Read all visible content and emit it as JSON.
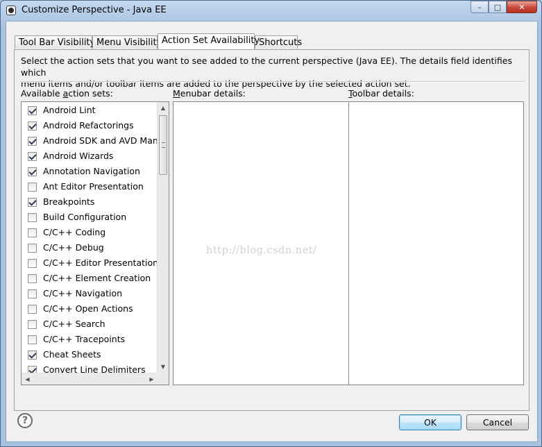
{
  "window": {
    "title": "Customize Perspective - Java EE",
    "buttons": {
      "minimize": "–",
      "maximize": "□",
      "close": "✕"
    }
  },
  "tabs": [
    {
      "label": "Tool Bar Visibility",
      "active": false
    },
    {
      "label": "Menu Visibility",
      "active": false
    },
    {
      "label": "Action Set Availability",
      "active": true
    },
    {
      "label": "Shortcuts",
      "active": false
    }
  ],
  "description_line1": "Select the action sets that you want to see added to the current perspective (Java EE).  The details field identifies which",
  "description_line2": "menu items and/or toolbar items are added to the perspective by the selected action set.",
  "labels": {
    "available_mnemonic": "a",
    "available_pre": "Available ",
    "available_post": "ction sets:",
    "menubar_mnemonic": "M",
    "menubar_post": "enubar details:",
    "toolbar_mnemonic": "T",
    "toolbar_post": "oolbar details:"
  },
  "action_sets": [
    {
      "label": "Android Lint",
      "checked": true
    },
    {
      "label": "Android Refactorings",
      "checked": true
    },
    {
      "label": "Android SDK and AVD Manager",
      "checked": true
    },
    {
      "label": "Android Wizards",
      "checked": true
    },
    {
      "label": "Annotation Navigation",
      "checked": true
    },
    {
      "label": "Ant Editor Presentation",
      "checked": false
    },
    {
      "label": "Breakpoints",
      "checked": true
    },
    {
      "label": "Build Configuration",
      "checked": false
    },
    {
      "label": "C/C++ Coding",
      "checked": false
    },
    {
      "label": "C/C++ Debug",
      "checked": false
    },
    {
      "label": "C/C++ Editor Presentation",
      "checked": false
    },
    {
      "label": "C/C++ Element Creation",
      "checked": false
    },
    {
      "label": "C/C++ Navigation",
      "checked": false
    },
    {
      "label": "C/C++ Open Actions",
      "checked": false
    },
    {
      "label": "C/C++ Search",
      "checked": false
    },
    {
      "label": "C/C++ Tracepoints",
      "checked": false
    },
    {
      "label": "Cheat Sheets",
      "checked": true
    },
    {
      "label": "Convert Line Delimiters",
      "checked": true
    }
  ],
  "watermark": "http://blog.csdn.net/",
  "footer": {
    "help": "?",
    "ok": "OK",
    "cancel": "Cancel"
  },
  "colors": {
    "title_bar": "#a7c1e1",
    "dialog_bg": "#f0f0f0",
    "close_button": "#c9473a",
    "default_button": "#a7d9f5"
  }
}
